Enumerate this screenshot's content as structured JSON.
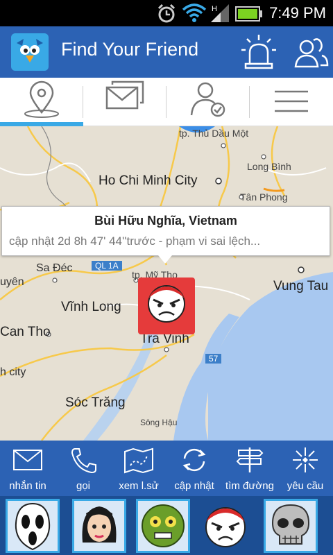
{
  "status_bar": {
    "time": "7:49 PM",
    "icons": [
      "alarm-clock-icon",
      "wifi-icon",
      "signal-icon",
      "battery-icon"
    ]
  },
  "app_bar": {
    "title": "Find Your Friend",
    "icons": [
      "app-logo-bird",
      "siren-icon",
      "friends-icon"
    ]
  },
  "tabs": [
    {
      "icon": "map-pin-icon",
      "active": true
    },
    {
      "icon": "messages-icon",
      "active": false
    },
    {
      "icon": "user-check-icon",
      "active": false
    },
    {
      "icon": "menu-icon",
      "active": false
    }
  ],
  "map": {
    "labels": {
      "thu_dau_mot": "tp. Thủ Dầu Một",
      "long_binh": "Long Bình",
      "hcm": "Ho Chi Minh City",
      "tan_phong": "Tân Phong",
      "sa_dec": "Sa Đéc",
      "ql1a": "QL 1A",
      "my_tho": "tp. Mỹ Tho",
      "vung_tau": "Vung Tau",
      "uyen": "uyên",
      "vinh_long": "Vĩnh Long",
      "can_tho": "Can Tho",
      "tra_vinh": "Tra Vinh",
      "route57": "57",
      "h_city": "h city",
      "soc_trang": "Sóc Trăng",
      "song_hau": "Sông Hậu"
    },
    "info_window": {
      "title": "Bùi Hữu Nghĩa, Vietnam",
      "subtitle": "cập nhật  2d 8h 47' 44''trước - phạm vi sai lệch..."
    },
    "marker_icon": "angry-face-icon"
  },
  "actions": [
    {
      "label": "nhắn tin",
      "icon": "envelope-icon"
    },
    {
      "label": "gọi",
      "icon": "phone-icon"
    },
    {
      "label": "xem l.sử",
      "icon": "map-history-icon"
    },
    {
      "label": "cập nhật",
      "icon": "refresh-icon"
    },
    {
      "label": "tìm đường",
      "icon": "signpost-icon"
    },
    {
      "label": "yêu cầu",
      "icon": "request-icon"
    }
  ],
  "friends": [
    {
      "avatar": "ghost-mask-avatar",
      "selected": false
    },
    {
      "avatar": "girl-avatar",
      "selected": false
    },
    {
      "avatar": "zombie-avatar",
      "selected": false
    },
    {
      "avatar": "angry-face-avatar",
      "selected": true
    },
    {
      "avatar": "skull-avatar",
      "selected": false
    }
  ],
  "colors": {
    "primary": "#2c62b4",
    "accent": "#39a9e6",
    "marker": "#e53b3b",
    "strip": "#1c4e93",
    "map_land": "#e6e0d3",
    "map_water": "#a8c8f0",
    "map_road": "#f7c94a"
  }
}
